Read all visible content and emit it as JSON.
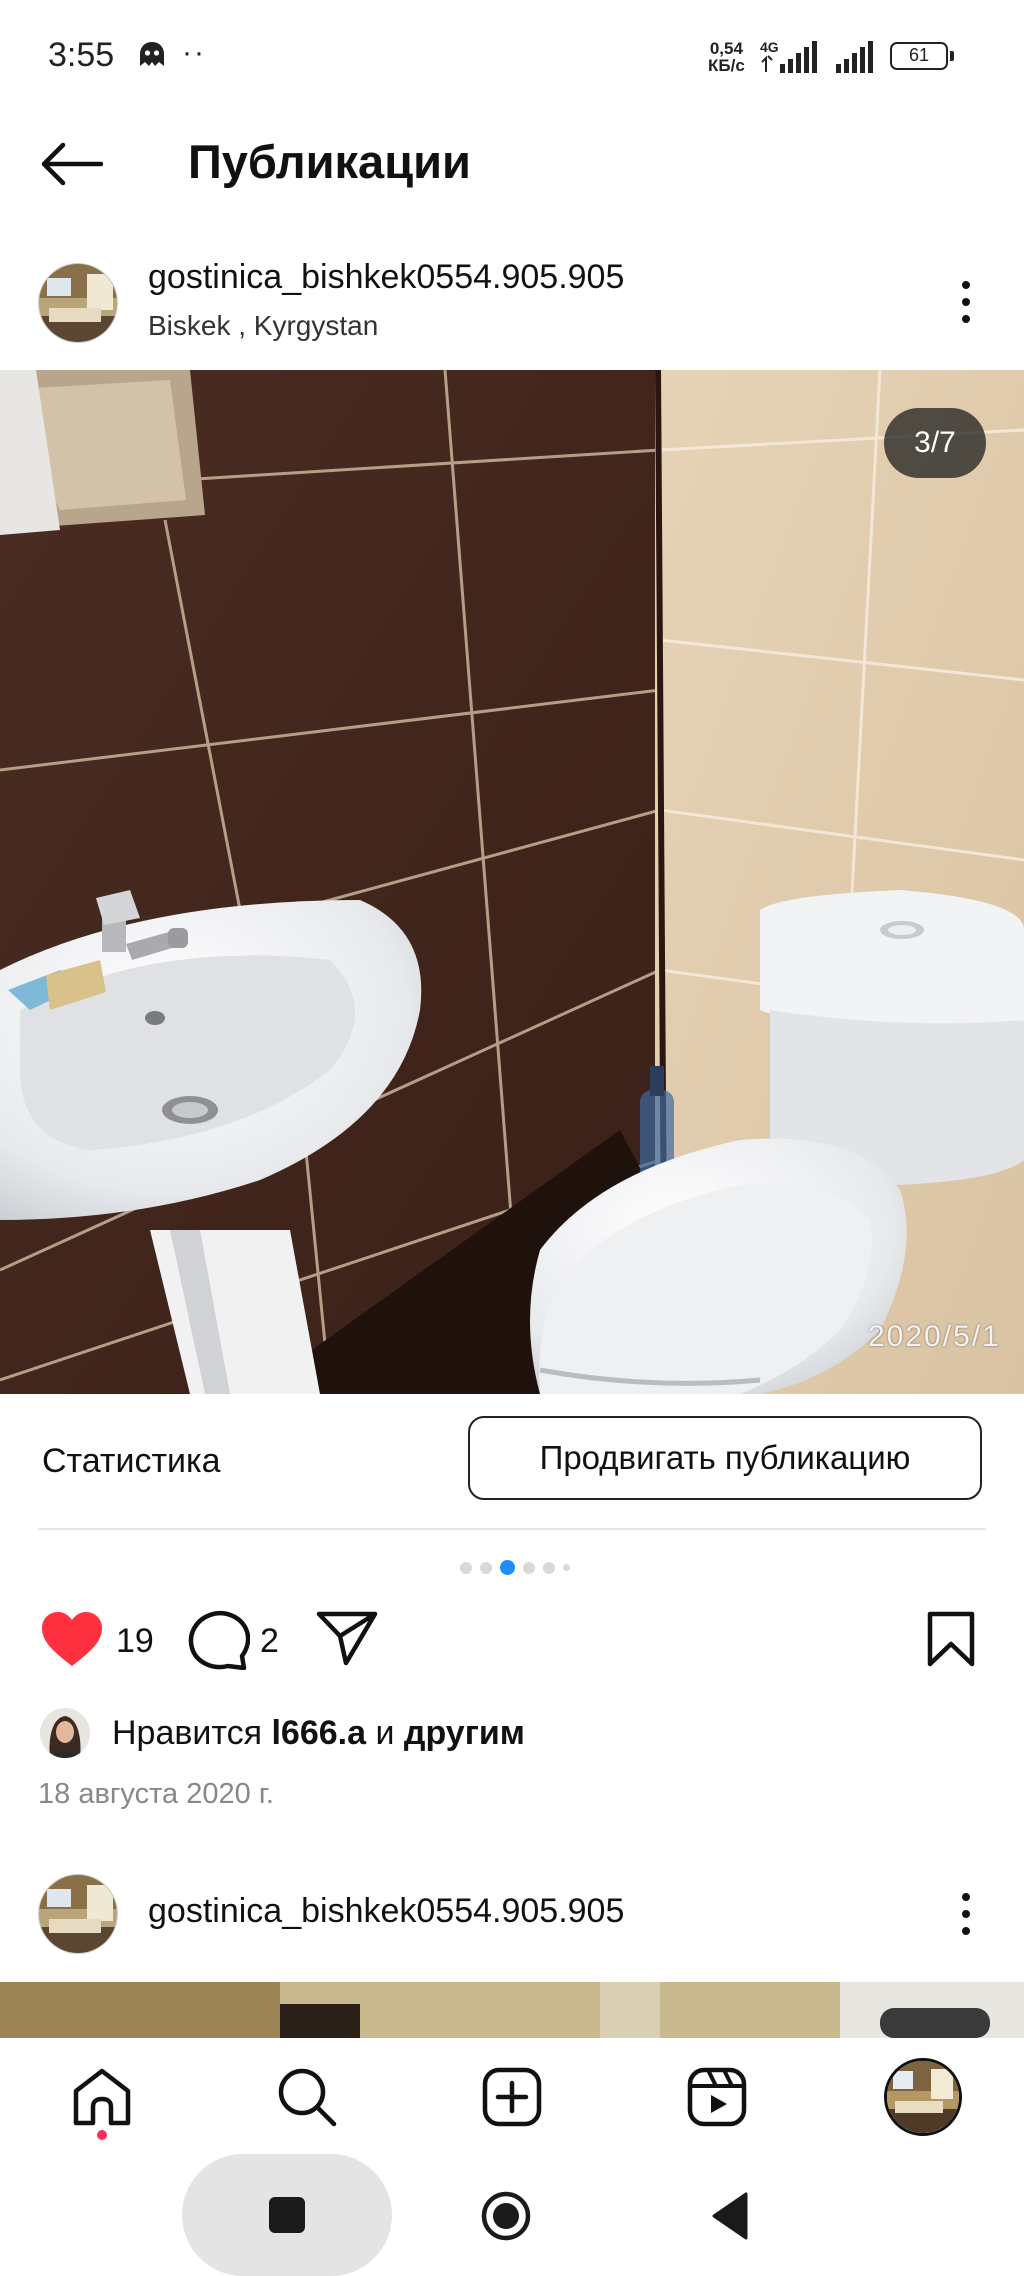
{
  "status_bar": {
    "time": "3:55",
    "dots": "··",
    "speed_value": "0,54",
    "speed_unit": "КБ/с",
    "network": "4G",
    "battery": "61"
  },
  "header": {
    "title": "Публикации",
    "back_icon": "arrow-left-icon"
  },
  "post": {
    "username": "gostinica_bishkek0554.905.905",
    "location": "Biskek , Kyrgystan",
    "photo_counter": "3/7",
    "photo_timestamp": "2020/5/1",
    "stats_label": "Статистика",
    "promote_label": "Продвигать публикацию",
    "likes": "19",
    "comments": "2",
    "liked_by_prefix": "Нравится ",
    "liked_by_user": "l666.a",
    "liked_by_mid": " и ",
    "liked_by_others": "другим",
    "date": "18 августа 2020 г.",
    "carousel_active_index": 3,
    "carousel_total": 7
  },
  "next_post": {
    "username": "gostinica_bishkek0554.905.905"
  },
  "bottom_nav": {
    "items": [
      "home-icon",
      "search-icon",
      "create-icon",
      "reels-icon",
      "profile-avatar"
    ]
  },
  "colors": {
    "like_red": "#ff3040",
    "carousel_active": "#1f8ef0",
    "notification_dot": "#ff2d55"
  }
}
